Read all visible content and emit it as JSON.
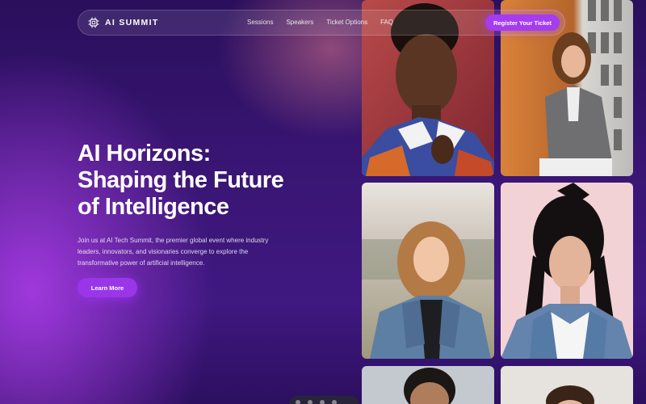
{
  "nav": {
    "logo_text": "AI SUMMIT",
    "links": [
      "Sessions",
      "Speakers",
      "Ticket Options",
      "FAQ"
    ],
    "register_label": "Register Your Ticket"
  },
  "hero": {
    "title_lines": [
      "AI Horizons:",
      "Shaping the Future",
      "of Intelligence"
    ],
    "description": "Join us at AI Tech Summit, the premier global event where industry leaders, innovators, and visionaries converge to explore the transformative power of artificial intelligence.",
    "cta_label": "Learn More"
  },
  "colors": {
    "background": "#3a1675",
    "accent": "#a53cf0"
  },
  "icons": {
    "logo": "chip-icon"
  }
}
